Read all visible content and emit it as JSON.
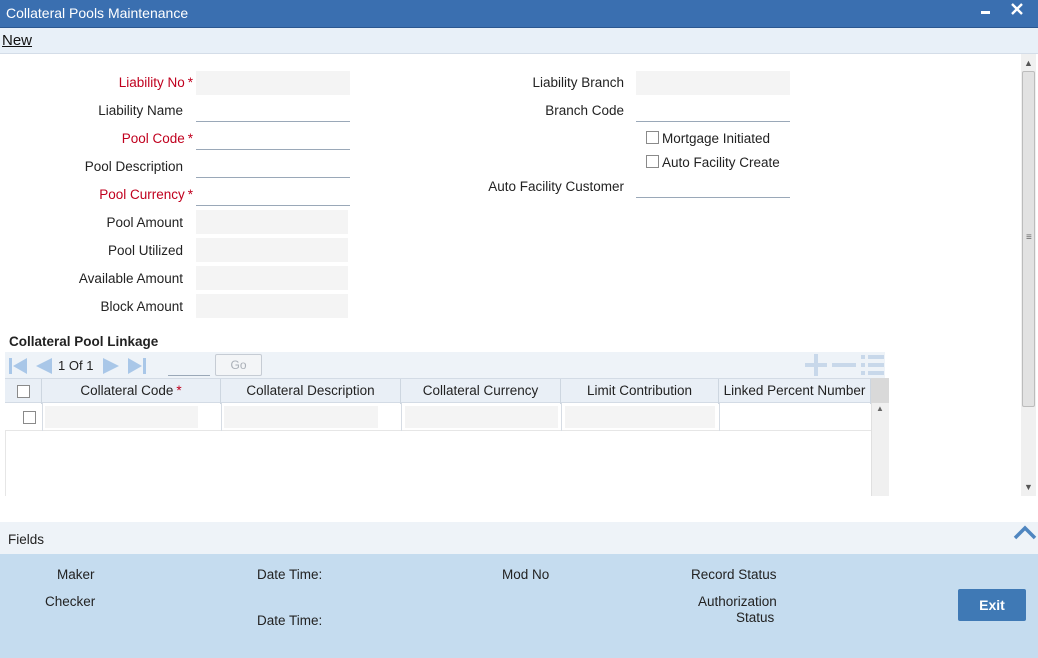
{
  "window": {
    "title": "Collateral Pools Maintenance",
    "minimize_label": "▁",
    "close_label": "✕"
  },
  "toolbar": {
    "new_label": "New"
  },
  "form": {
    "liability_no_label": "Liability No",
    "liability_name_label": "Liability Name",
    "pool_code_label": "Pool Code",
    "pool_description_label": "Pool Description",
    "pool_currency_label": "Pool Currency",
    "pool_amount_label": "Pool Amount",
    "pool_utilized_label": "Pool Utilized",
    "available_amount_label": "Available Amount",
    "block_amount_label": "Block Amount",
    "liability_branch_label": "Liability Branch",
    "branch_code_label": "Branch Code",
    "mortgage_initiated_label": "Mortgage Initiated",
    "auto_facility_create_label": "Auto Facility Create",
    "auto_facility_customer_label": "Auto Facility Customer",
    "required_marker": "*"
  },
  "linkage": {
    "title": "Collateral Pool Linkage",
    "page_current": "1",
    "page_of": "Of",
    "page_total": "1",
    "go_label": "Go",
    "columns": [
      "Collateral Code",
      "Collateral Description",
      "Collateral Currency",
      "Limit Contribution",
      "Linked Percent Number"
    ],
    "required_marker": "*"
  },
  "fields_bar": {
    "label": "Fields"
  },
  "footer": {
    "maker_label": "Maker",
    "checker_label": "Checker",
    "date_time_label_1": "Date Time:",
    "date_time_label_2": "Date Time:",
    "mod_no_label": "Mod No",
    "record_status_label": "Record Status",
    "authorization_label": "Authorization",
    "status_label": "Status",
    "exit_label": "Exit"
  },
  "colors": {
    "title_bar": "#3a6fb0",
    "required_text": "#c0001e",
    "footer_bg": "#c5dcef",
    "exit_button": "#3f79b5",
    "pager_icons": "#a9c7e8"
  }
}
